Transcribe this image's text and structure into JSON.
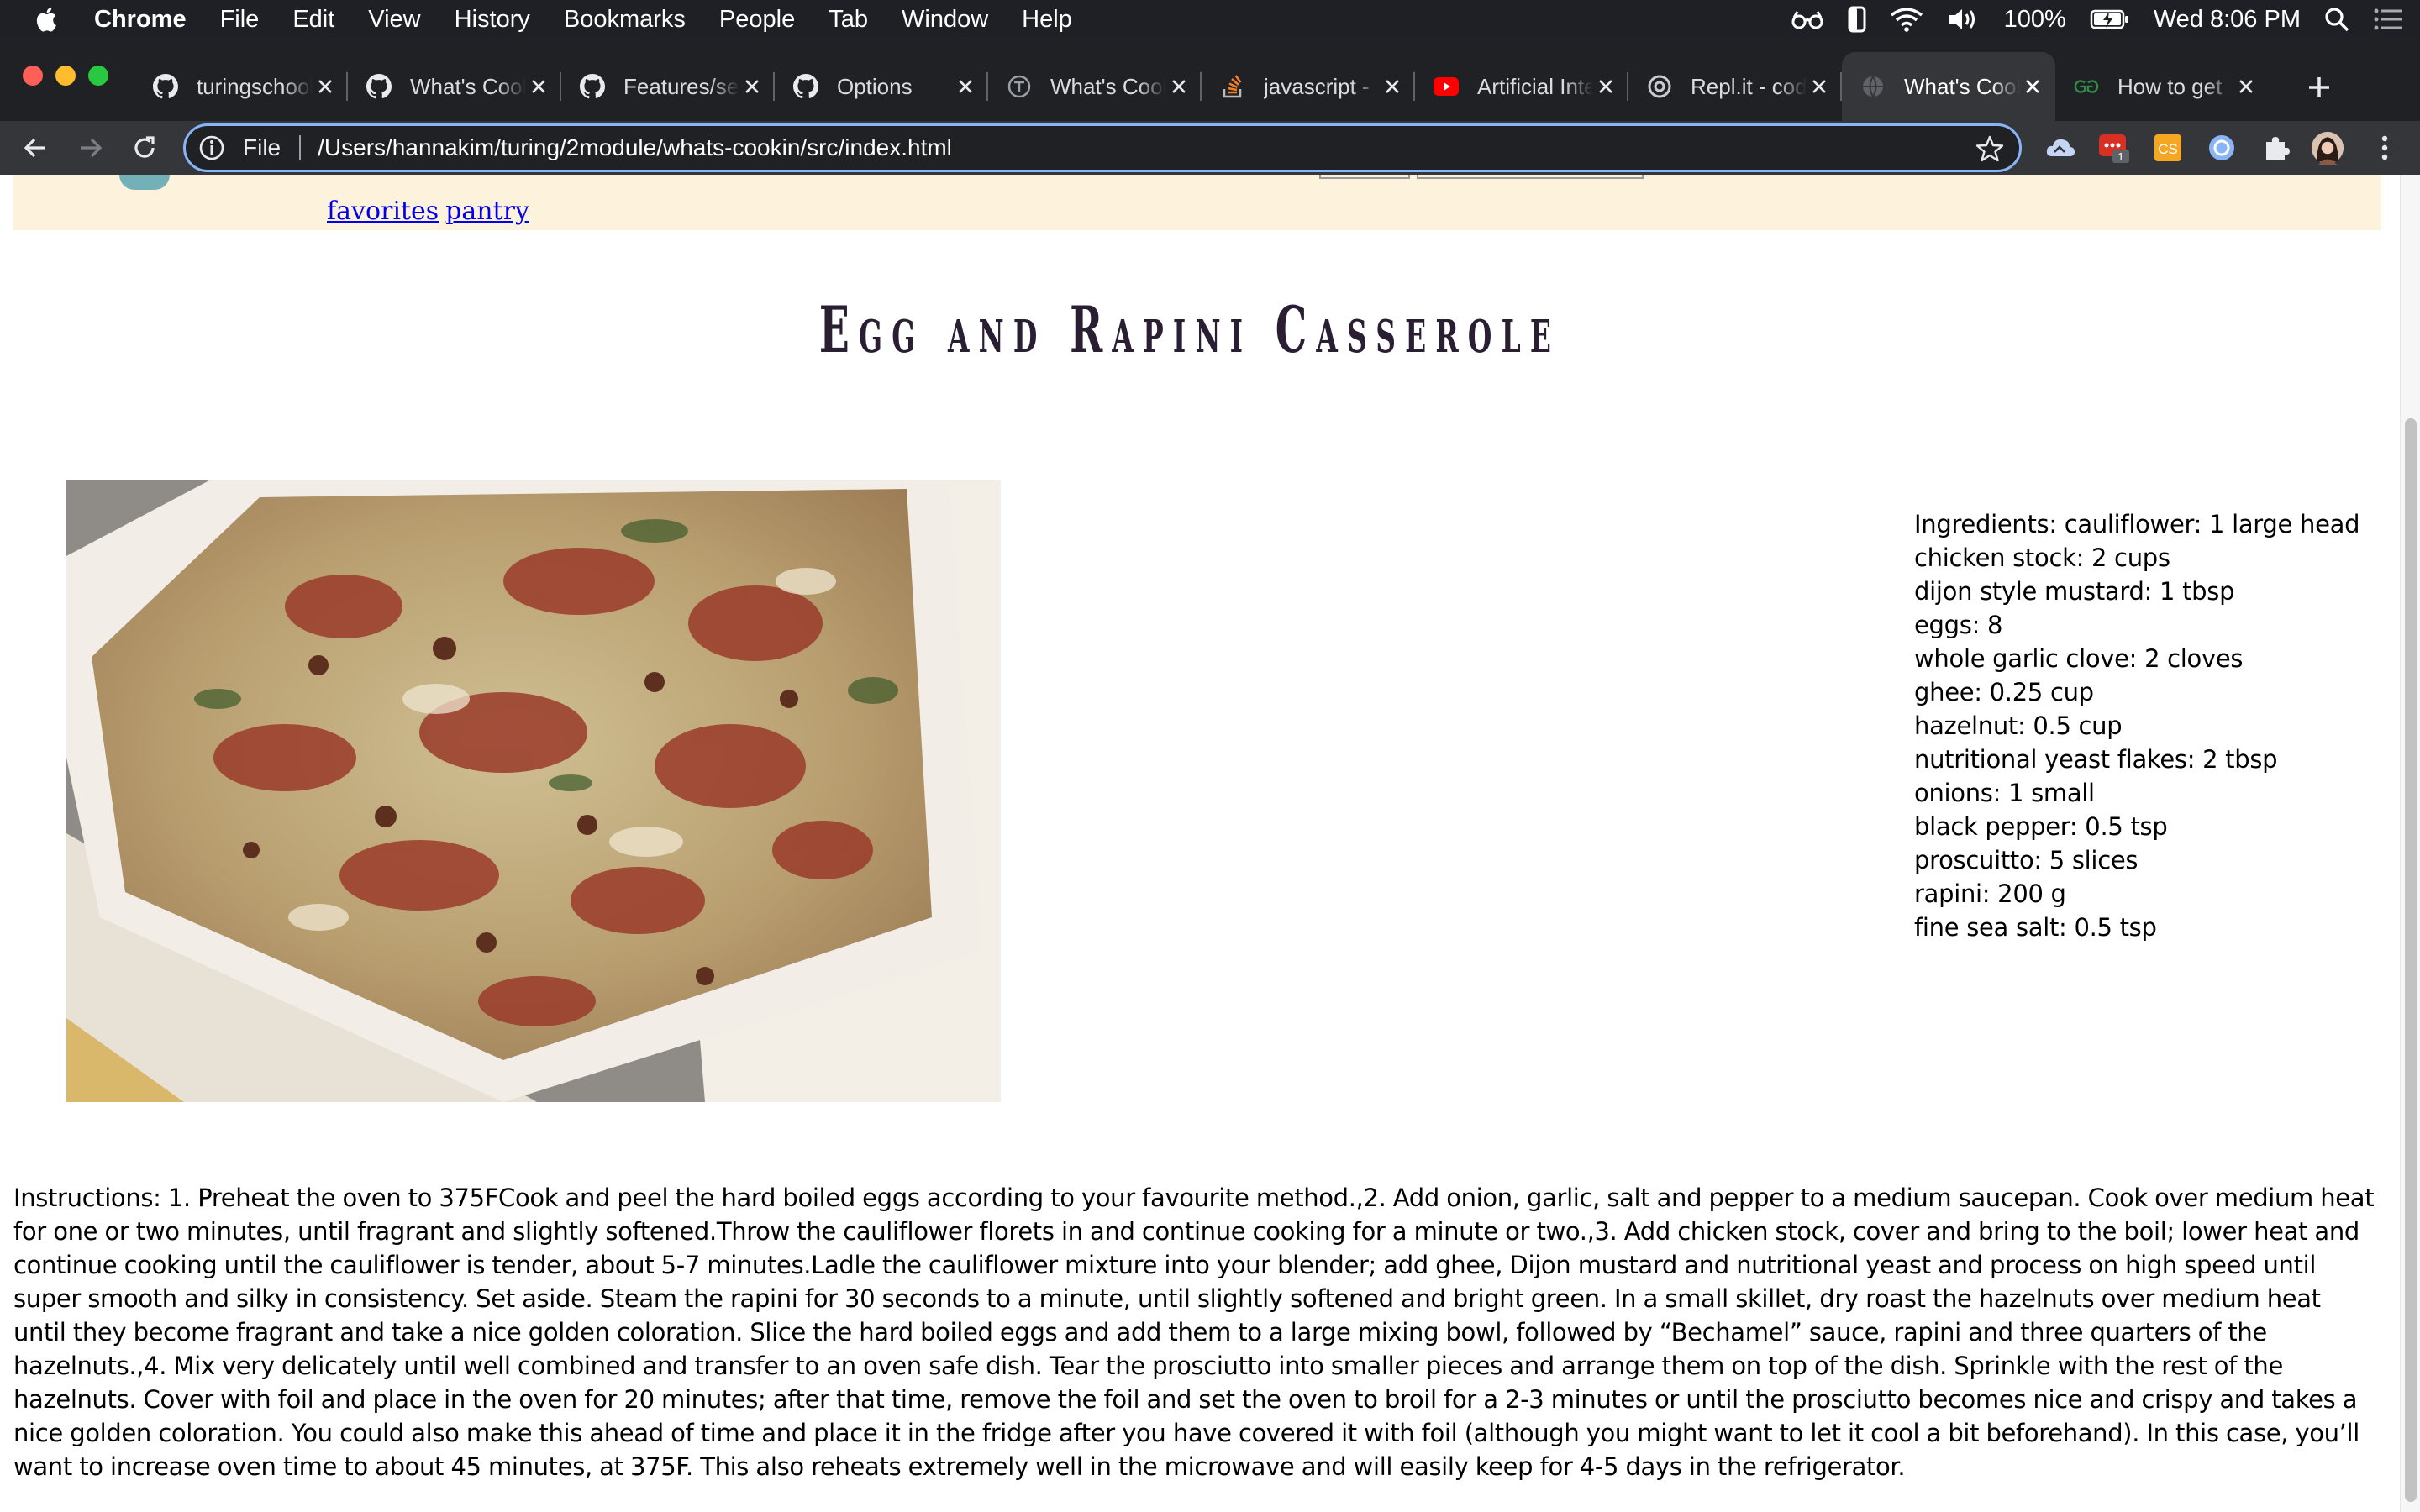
{
  "menubar": {
    "app_name": "Chrome",
    "items": [
      "File",
      "Edit",
      "View",
      "History",
      "Bookmarks",
      "People",
      "Tab",
      "Window",
      "Help"
    ],
    "battery": "100%",
    "clock": "Wed 8:06 PM",
    "icons": [
      "apple-icon",
      "reading-glasses-icon",
      "phone-icon",
      "wifi-icon",
      "volume-icon",
      "battery-icon",
      "spotlight-icon",
      "notification-center-icon"
    ]
  },
  "tabs": [
    {
      "title": "turingschool",
      "icon": "github-icon"
    },
    {
      "title": "What's Cookin",
      "icon": "github-icon"
    },
    {
      "title": "Features/search",
      "icon": "github-icon"
    },
    {
      "title": "Options",
      "icon": "github-icon"
    },
    {
      "title": "What's Cookin",
      "icon": "turing-icon"
    },
    {
      "title": "javascript - ",
      "icon": "stackoverflow-icon"
    },
    {
      "title": "Artificial Intelligence",
      "icon": "youtube-icon"
    },
    {
      "title": "Repl.it - code",
      "icon": "replit-icon"
    },
    {
      "title": "What's Cookin",
      "icon": "globe-icon",
      "active": true
    },
    {
      "title": "How to get",
      "icon": "geeksforgeeks-icon"
    }
  ],
  "toolbar": {
    "scheme": "File",
    "url": "/Users/hannakim/turing/2module/whats-cookin/src/index.html",
    "extension_badge": "1",
    "extension_text": "CS"
  },
  "nav": {
    "favorites": "favorites",
    "pantry": "pantry"
  },
  "recipe": {
    "title": "Egg and Rapini Casserole",
    "ingredients": [
      "Ingredients: cauliflower: 1 large head",
      "chicken stock: 2 cups",
      "dijon style mustard: 1 tbsp",
      "eggs: 8",
      "whole garlic clove: 2 cloves",
      "ghee: 0.25 cup",
      "hazelnut: 0.5 cup",
      "nutritional yeast flakes: 2 tbsp",
      "onions: 1 small",
      "black pepper: 0.5 tsp",
      "proscuitto: 5 slices",
      "rapini: 200 g",
      "fine sea salt: 0.5 tsp"
    ],
    "instructions": "Instructions: 1. Preheat the oven to 375FCook and peel the hard boiled eggs according to your favourite method.,2. Add onion, garlic, salt and pepper to a medium saucepan. Cook over medium heat for one or two minutes, until fragrant and slightly softened.Throw the cauliflower florets in and continue cooking for a minute or two.,3. Add chicken stock, cover and bring to the boil; lower heat and continue cooking until the cauliflower is tender, about 5-7 minutes.Ladle the cauliflower mixture into your blender; add ghee, Dijon mustard and nutritional yeast and process on high speed until super smooth and silky in consistency. Set aside. Steam the rapini for 30 seconds to a minute, until slightly softened and bright green. In a small skillet, dry roast the hazelnuts over medium heat until they become fragrant and take a nice golden coloration. Slice the hard boiled eggs and add them to a large mixing bowl, followed by “Bechamel” sauce, rapini and three quarters of the hazelnuts.,4. Mix very delicately until well combined and transfer to an oven safe dish. Tear the prosciutto into smaller pieces and arrange them on top of the dish. Sprinkle with the rest of the hazelnuts. Cover with foil and place in the oven for 20 minutes; after that time, remove the foil and set the oven to broil for a 2-3 minutes or until the prosciutto becomes nice and crispy and takes a nice golden coloration. You could also make this ahead of time and place it in the fridge after you have covered it with foil (although you might want to let it cool a bit beforehand). In this case, you’ll want to increase oven time to about 45 minutes, at 375F. This also reheats extremely well in the microwave and will easily keep for 4-5 days in the refrigerator."
  },
  "colors": {
    "header_band": "#fdf3dc",
    "link": "#0000ee",
    "title": "#2a1e33",
    "omnibox_focus": "#8ab4f8"
  }
}
